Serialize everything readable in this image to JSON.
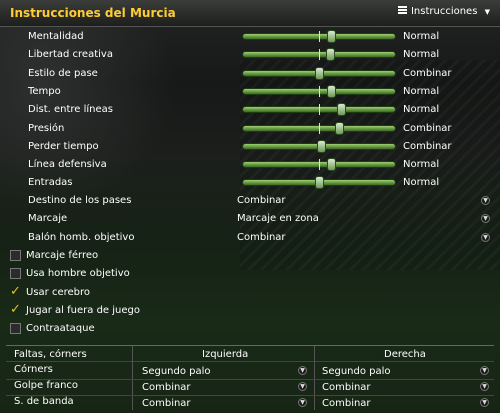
{
  "window": {
    "title": "Instrucciones del Murcia",
    "menu_label": "Instrucciones",
    "menu_arrow": "▼"
  },
  "sliders": [
    {
      "label": "Mentalidad",
      "value": "Normal",
      "level": 0.58
    },
    {
      "label": "Libertad creativa",
      "value": "Normal",
      "level": 0.57
    },
    {
      "label": "Estilo de pase",
      "value": "Combinar",
      "level": 0.5
    },
    {
      "label": "Tempo",
      "value": "Normal",
      "level": 0.58
    },
    {
      "label": "Dist. entre líneas",
      "value": "Normal",
      "level": 0.64
    },
    {
      "label": "Presión",
      "value": "Combinar",
      "level": 0.63
    },
    {
      "label": "Perder tiempo",
      "value": "Combinar",
      "level": 0.51
    },
    {
      "label": "Línea defensiva",
      "value": "Normal",
      "level": 0.58
    },
    {
      "label": "Entradas",
      "value": "Normal",
      "level": 0.5
    }
  ],
  "selects": [
    {
      "label": "Destino de los pases",
      "value": "Combinar"
    },
    {
      "label": "Marcaje",
      "value": "Marcaje en zona"
    },
    {
      "label": "Balón homb. objetivo",
      "value": "Combinar"
    }
  ],
  "checkboxes": [
    {
      "label": "Marcaje férreo",
      "checked": false
    },
    {
      "label": "Usa hombre objetivo",
      "checked": false
    },
    {
      "label": "Usar cerebro",
      "checked": true
    },
    {
      "label": "Jugar al fuera de juego",
      "checked": true
    },
    {
      "label": "Contraataque",
      "checked": false
    }
  ],
  "set_pieces": {
    "header_label": "Faltas, córners",
    "col_left": "Izquierda",
    "col_right": "Derecha",
    "rows": [
      {
        "label": "Córners",
        "left": "Segundo palo",
        "right": "Segundo palo"
      },
      {
        "label": "Golpe franco",
        "left": "Combinar",
        "right": "Combinar"
      },
      {
        "label": "S. de banda",
        "left": "Combinar",
        "right": "Combinar"
      }
    ]
  },
  "colors": {
    "accent_title": "#ffcc33",
    "check_mark": "#e8c21a",
    "slider_green": "#6fa84a"
  },
  "icons": {
    "menu": "menu-icon",
    "check": "check-icon",
    "select": "select-arrow-icon"
  }
}
